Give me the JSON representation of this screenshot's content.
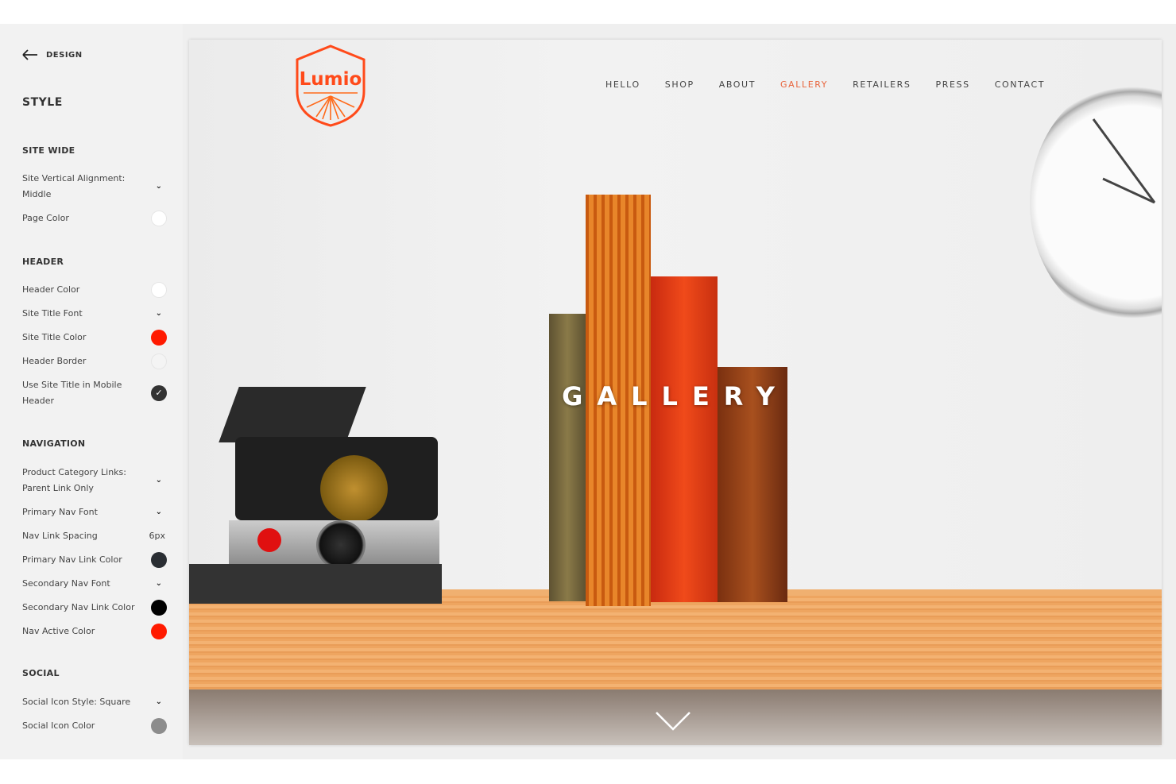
{
  "sidebar": {
    "back_label": "DESIGN",
    "title": "STYLE",
    "sections": {
      "site_wide": "SITE WIDE",
      "header": "HEADER",
      "navigation": "NAVIGATION",
      "social": "SOCIAL"
    },
    "items": [
      {
        "label": "Site Vertical Alignment: Middle",
        "control": "dropdown"
      },
      {
        "label": "Page Color",
        "control": "color",
        "color": "#ffffff"
      },
      {
        "label": "Header Color",
        "control": "color",
        "color": "#ffffff"
      },
      {
        "label": "Site Title Font",
        "control": "dropdown"
      },
      {
        "label": "Site Title Color",
        "control": "color",
        "color": "#ff1a00"
      },
      {
        "label": "Header Border",
        "control": "color",
        "color": "#f4f4f4"
      },
      {
        "label": "Use Site Title in Mobile Header",
        "control": "checkbox",
        "checked": true
      },
      {
        "label": "Product Category Links: Parent Link Only",
        "control": "dropdown"
      },
      {
        "label": "Primary Nav Font",
        "control": "dropdown"
      },
      {
        "label": "Nav Link Spacing",
        "control": "value",
        "value": "6px"
      },
      {
        "label": "Primary Nav Link Color",
        "control": "color",
        "color": "#2a2e33"
      },
      {
        "label": "Secondary Nav Font",
        "control": "dropdown"
      },
      {
        "label": "Secondary Nav Link Color",
        "control": "color",
        "color": "#000000"
      },
      {
        "label": "Nav Active Color",
        "control": "color",
        "color": "#ff1a00"
      },
      {
        "label": "Social Icon Style: Square",
        "control": "dropdown"
      },
      {
        "label": "Social Icon Color",
        "control": "color",
        "color": "#8c8c8c"
      }
    ]
  },
  "site": {
    "logo_text": "Lumio",
    "logo_color": "#ff4a1a",
    "nav": [
      "HELLO",
      "SHOP",
      "ABOUT",
      "GALLERY",
      "RETAILERS",
      "PRESS",
      "CONTACT"
    ],
    "active_nav": "GALLERY",
    "active_color": "#e8643c",
    "hero_title": "GALLERY",
    "scroll_icon": "chevron-down-icon"
  }
}
